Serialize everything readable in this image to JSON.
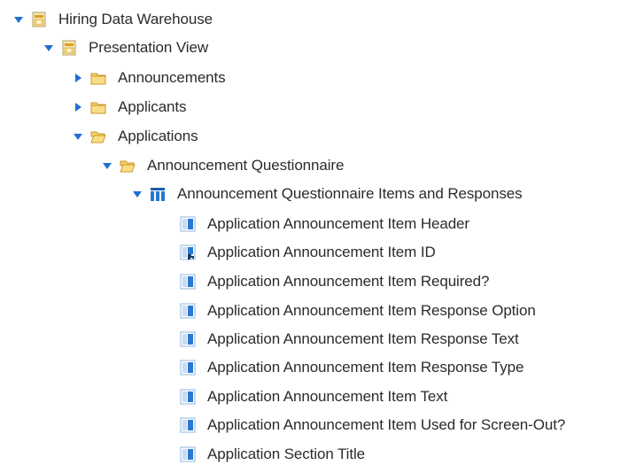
{
  "tree": {
    "root": {
      "label": "Hiring Data Warehouse",
      "icon": "package-icon"
    },
    "presentation": {
      "label": "Presentation View",
      "icon": "package-icon"
    },
    "folders": [
      {
        "label": "Announcements",
        "icon": "folder-closed-icon",
        "expanded": false
      },
      {
        "label": "Applicants",
        "icon": "folder-closed-icon",
        "expanded": false
      },
      {
        "label": "Applications",
        "icon": "folder-open-icon",
        "expanded": true
      }
    ],
    "subfolder": {
      "label": "Announcement Questionnaire",
      "icon": "folder-open-icon",
      "expanded": true
    },
    "query_subject": {
      "label": "Announcement Questionnaire Items and Responses",
      "icon": "table-icon",
      "expanded": true
    },
    "items": [
      {
        "label": "Application Announcement Item Header",
        "icon": "column-icon"
      },
      {
        "label": "Application Announcement Item ID",
        "icon": "key-column-icon"
      },
      {
        "label": "Application Announcement Item Required?",
        "icon": "column-icon"
      },
      {
        "label": "Application Announcement Item Response Option",
        "icon": "column-icon"
      },
      {
        "label": "Application Announcement Item Response Text",
        "icon": "column-icon"
      },
      {
        "label": "Application Announcement Item Response Type",
        "icon": "column-icon"
      },
      {
        "label": "Application Announcement Item Text",
        "icon": "column-icon"
      },
      {
        "label": "Application Announcement Item Used for Screen-Out?",
        "icon": "column-icon"
      },
      {
        "label": "Application Section Title",
        "icon": "column-icon"
      }
    ]
  }
}
